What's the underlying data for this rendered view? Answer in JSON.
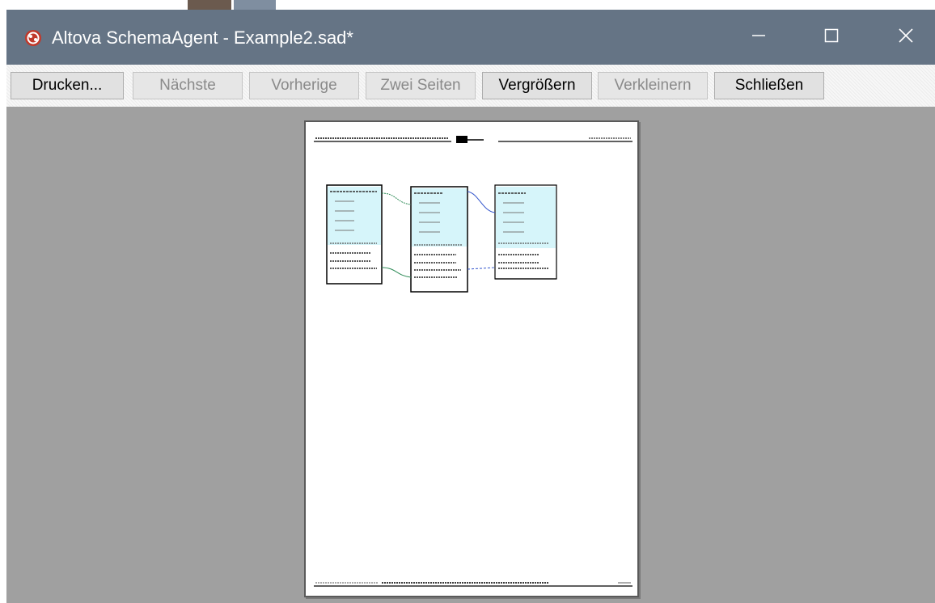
{
  "window": {
    "title": "Altova SchemaAgent - Example2.sad*"
  },
  "toolbar": {
    "buttons": [
      {
        "label": "Drucken...",
        "enabled": true
      },
      {
        "label": "Nächste",
        "enabled": false
      },
      {
        "label": "Vorherige",
        "enabled": false
      },
      {
        "label": "Zwei Seiten",
        "enabled": false
      },
      {
        "label": "Vergrößern",
        "enabled": true
      },
      {
        "label": "Verkleinern",
        "enabled": false
      },
      {
        "label": "Schließen",
        "enabled": true
      }
    ]
  },
  "icons": {
    "app": "schemaagent-logo-icon",
    "minimize": "minimize-icon",
    "maximize": "maximize-icon",
    "close": "close-icon"
  },
  "colors": {
    "titlebar": "#657485",
    "toolbar": "#f0f0f0",
    "preview_background": "#a0a0a0",
    "schema_box_fill": "#d6f5fa",
    "connector_green": "#2e8b57",
    "connector_blue": "#3355cc"
  }
}
